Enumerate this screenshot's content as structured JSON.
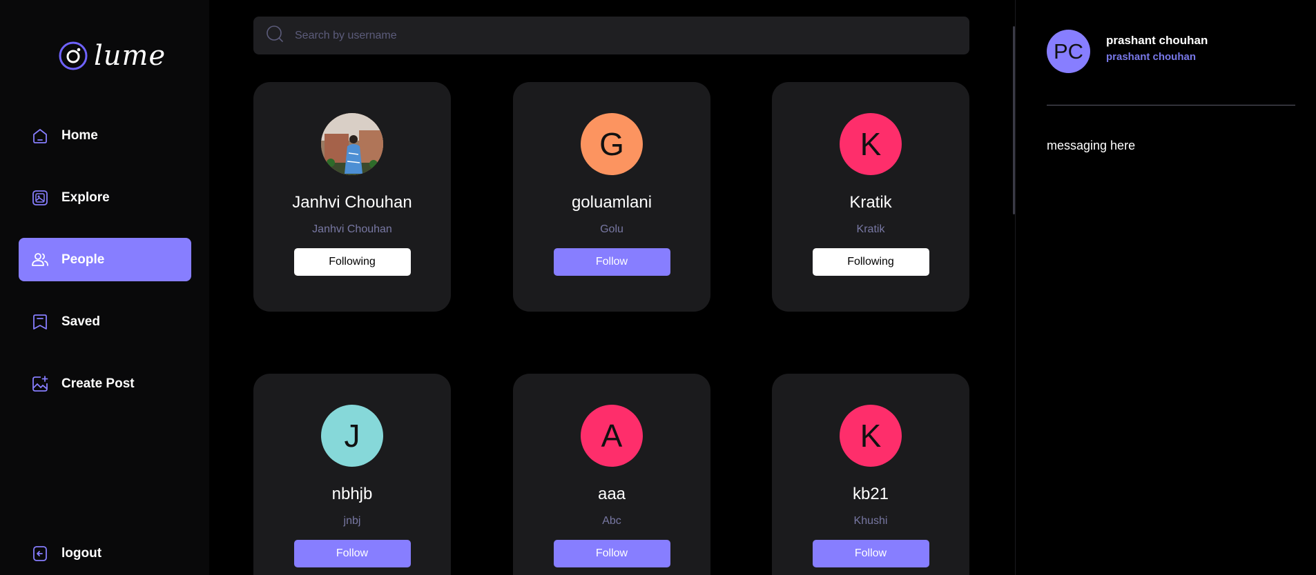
{
  "app": {
    "name": "lume"
  },
  "colors": {
    "accent": "#877eff",
    "background": "#000000",
    "card": "#1b1b1d"
  },
  "sidebar": {
    "items": [
      {
        "label": "Home",
        "icon": "home-icon"
      },
      {
        "label": "Explore",
        "icon": "explore-icon"
      },
      {
        "label": "People",
        "icon": "people-icon",
        "active": true
      },
      {
        "label": "Saved",
        "icon": "bookmark-icon"
      },
      {
        "label": "Create Post",
        "icon": "create-post-icon"
      }
    ],
    "logout_label": "logout"
  },
  "search": {
    "placeholder": "Search by username",
    "value": ""
  },
  "people": [
    {
      "name": "Janhvi Chouhan",
      "username": "Janhvi Chouhan",
      "button": "Following",
      "avatar_type": "photo"
    },
    {
      "name": "goluamlani",
      "username": "Golu",
      "button": "Follow",
      "initial": "G",
      "avatar_color": "#fc9460"
    },
    {
      "name": "Kratik",
      "username": "Kratik",
      "button": "Following",
      "initial": "K",
      "avatar_color": "#fe2e6b"
    },
    {
      "name": "nbhjb",
      "username": "jnbj",
      "button": "Follow",
      "initial": "J",
      "avatar_color": "#86d8d9"
    },
    {
      "name": "aaa",
      "username": "Abc",
      "button": "Follow",
      "initial": "A",
      "avatar_color": "#fe2e6b"
    },
    {
      "name": "kb21",
      "username": "Khushi",
      "button": "Follow",
      "initial": "K",
      "avatar_color": "#fe2e6b"
    }
  ],
  "rightbar": {
    "profile": {
      "initials": "PC",
      "name": "prashant chouhan",
      "username": "prashant chouhan"
    },
    "messaging_text": "messaging here"
  }
}
